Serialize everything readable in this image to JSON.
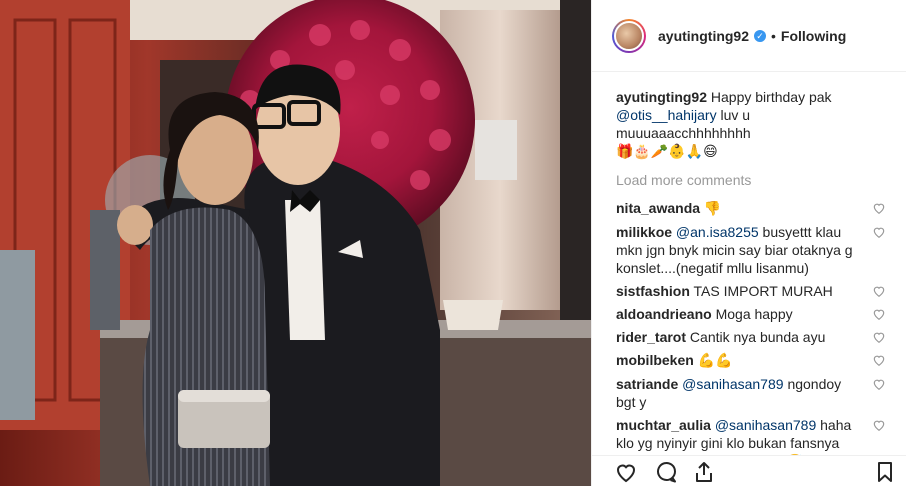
{
  "post": {
    "username": "ayutingting92",
    "follow_state": "Following",
    "separator": "•",
    "verified_mark": "✓"
  },
  "caption": {
    "username": "ayutingting92",
    "text1": "Happy birthday pak",
    "mention": "@otis__hahijary",
    "text2": "luv u muuuaaacchhhhhhhh",
    "emojis": "🎁🎂🥕👶🙏😄"
  },
  "load_more": "Load more comments",
  "comments": [
    {
      "username": "nita_awanda",
      "mention": "",
      "text": "👎"
    },
    {
      "username": "milikkoe",
      "mention": "@an.isa8255",
      "text": "busyettt klau mkn jgn bnyk micin say biar otaknya g konslet....(negatif mllu lisanmu)"
    },
    {
      "username": "sistfashion",
      "mention": "",
      "text": "TAS IMPORT MURAH"
    },
    {
      "username": "aldoandrieano",
      "mention": "",
      "text": "Moga happy"
    },
    {
      "username": "rider_tarot",
      "mention": "",
      "text": "Cantik nya bunda ayu"
    },
    {
      "username": "mobilbeken",
      "mention": "",
      "text": "💪💪"
    },
    {
      "username": "satriande",
      "mention": "@sanihasan789",
      "text": "ngondoy bgt y"
    },
    {
      "username": "muchtar_aulia",
      "mention": "@sanihasan789",
      "text": "haha klo yg nyinyir gini klo bukan fansnya gigi pasti fansnya via vallen😅jujur klo"
    }
  ],
  "icons": {
    "like": "heart-icon",
    "comment": "comment-icon",
    "share": "share-icon",
    "save": "bookmark-icon"
  },
  "colors": {
    "mention": "#003569",
    "muted": "#999999",
    "verified": "#3897f0"
  }
}
